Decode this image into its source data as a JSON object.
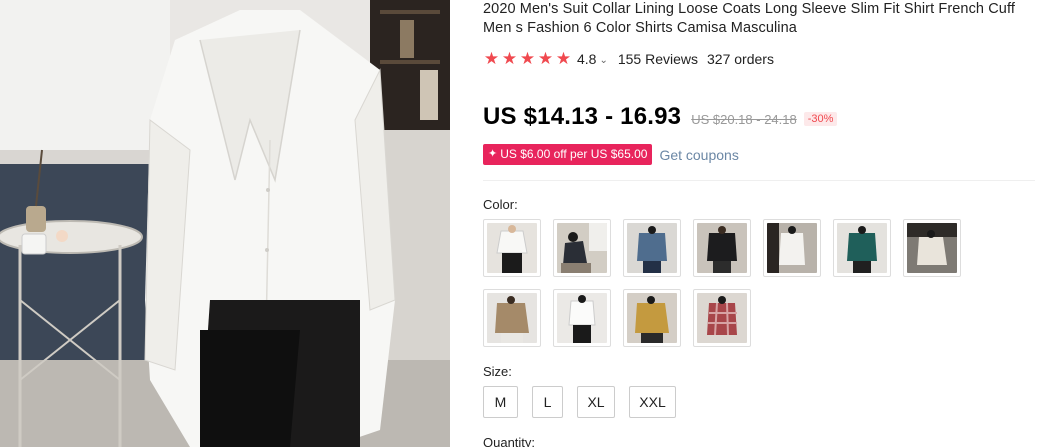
{
  "product": {
    "title": "2020 Men's Suit Collar Lining Loose Coats Long Sleeve Slim Fit Shirt French Cuff Men s Fashion 6 Color Shirts Camisa Masculina",
    "rating": "4.8",
    "rating_stars": 5,
    "reviews": "155 Reviews",
    "orders": "327 orders",
    "price": "US $14.13 - 16.93",
    "original_price": "US $20.18 - 24.18",
    "discount": "-30%",
    "coupon_badge": "US $6.00 off per US $65.00",
    "get_coupons": "Get coupons",
    "star_color": "#f0494f",
    "coupon_color": "#e8245c",
    "link_color": "#6b87a5"
  },
  "color_section": {
    "label": "Color:",
    "options": [
      {
        "name": "white-shirt-black-pants"
      },
      {
        "name": "dark-shirt-seated"
      },
      {
        "name": "denim-blue-shirt"
      },
      {
        "name": "black-shirt"
      },
      {
        "name": "white-shirt-bedroom"
      },
      {
        "name": "teal-green-shirt"
      },
      {
        "name": "beige-shirt-mirror"
      },
      {
        "name": "khaki-shirt"
      },
      {
        "name": "white-shirt-full"
      },
      {
        "name": "mustard-shirt"
      },
      {
        "name": "red-plaid-shirt"
      }
    ]
  },
  "size_section": {
    "label": "Size:",
    "options": [
      "M",
      "L",
      "XL",
      "XXL"
    ]
  },
  "quantity_section": {
    "label": "Quantity:"
  }
}
